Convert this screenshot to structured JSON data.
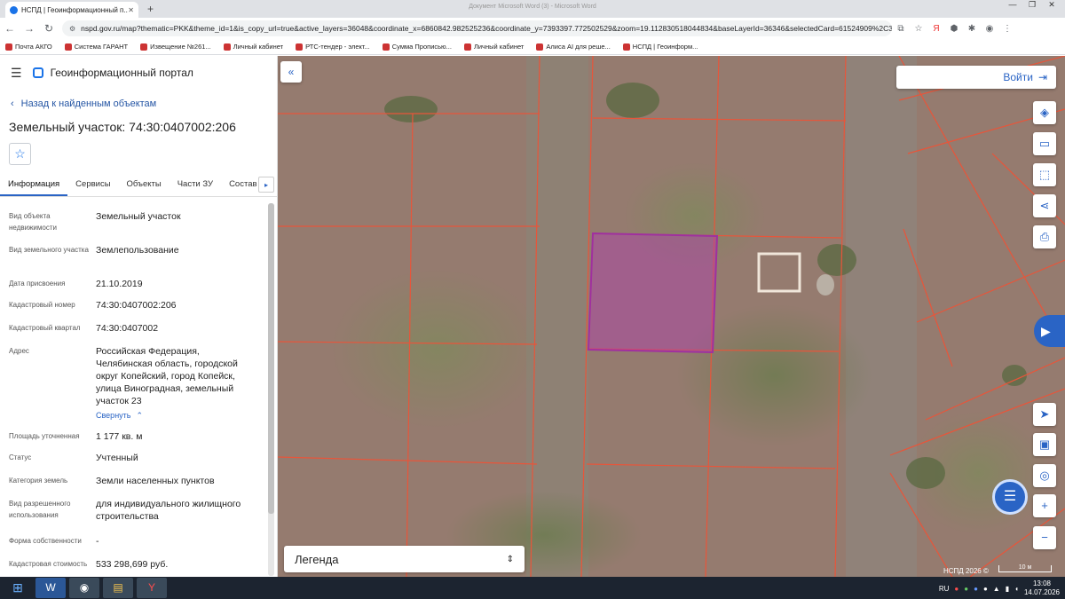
{
  "browser": {
    "tab_title": "НСПД | Геоинформационный п...",
    "window_title": "Документ Microsoft Word (3) - Microsoft Word",
    "url": "nspd.gov.ru/map?thematic=PKK&theme_id=1&is_copy_url=true&active_layers=36048&coordinate_x=6860842.982525236&coordinate_y=7393397.772502529&zoom=19.112830518044834&baseLayerId=36346&selectedCard=61524909%2C3...",
    "bookmarks": [
      {
        "label": "Почта АКГО"
      },
      {
        "label": "Система ГАРАНТ"
      },
      {
        "label": "Извещение №261..."
      },
      {
        "label": "Личный кабинет"
      },
      {
        "label": "РТС-тендер - элект..."
      },
      {
        "label": "Сумма Прописью..."
      },
      {
        "label": "Личный кабинет"
      },
      {
        "label": "Алиса AI для реше..."
      },
      {
        "label": "НСПД | Геоинформ..."
      }
    ]
  },
  "panel": {
    "portal_title": "Геоинформационный портал",
    "back_label": "Назад к найденным объектам",
    "object_title": "Земельный участок: 74:30:0407002:206",
    "tabs": [
      {
        "label": "Информация"
      },
      {
        "label": "Сервисы"
      },
      {
        "label": "Объекты"
      },
      {
        "label": "Части ЗУ"
      },
      {
        "label": "Состав"
      }
    ],
    "collapse_label": "Свернуть",
    "attributes": [
      {
        "label": "Вид объекта недвижимости",
        "value": "Земельный участок"
      },
      {
        "label": "Вид земельного участка",
        "value": "Землепользование"
      },
      {
        "label": "Дата присвоения",
        "value": "21.10.2019"
      },
      {
        "label": "Кадастровый номер",
        "value": "74:30:0407002:206"
      },
      {
        "label": "Кадастровый квартал",
        "value": "74:30:0407002"
      },
      {
        "label": "Адрес",
        "value": "Российская Федерация, Челябинская область, городской округ Копейский, город Копейск, улица Виноградная, земельный участок 23"
      },
      {
        "label": "Площадь уточненная",
        "value": "1 177 кв. м"
      },
      {
        "label": "Статус",
        "value": "Учтенный"
      },
      {
        "label": "Категория земель",
        "value": "Земли населенных пунктов"
      },
      {
        "label": "Вид разрешенного использования",
        "value": "для индивидуального жилищного строительства"
      },
      {
        "label": "Форма собственности",
        "value": "-"
      },
      {
        "label": "Кадастровая стоимость",
        "value": "533 298,699 руб."
      }
    ]
  },
  "map": {
    "login_label": "Войти",
    "legend_label": "Легенда",
    "attribution": "НСПД 2026 ©",
    "scale_label": "10 м",
    "colors": {
      "parcel_lines": "#e8553a",
      "selected_parcel": "#b03fb0",
      "accent": "#2a64c5"
    },
    "tools": [
      "layers-icon",
      "ruler-icon",
      "select-area-icon",
      "share-icon",
      "print-icon",
      "navigate-icon",
      "basemap-icon",
      "locate-icon",
      "zoom-in-icon",
      "zoom-out-icon"
    ]
  },
  "taskbar": {
    "lang": "RU",
    "time": "13:08",
    "date": "14.07.2026",
    "apps": [
      "word-icon",
      "chrome-icon",
      "explorer-icon",
      "yandex-browser-icon"
    ]
  }
}
